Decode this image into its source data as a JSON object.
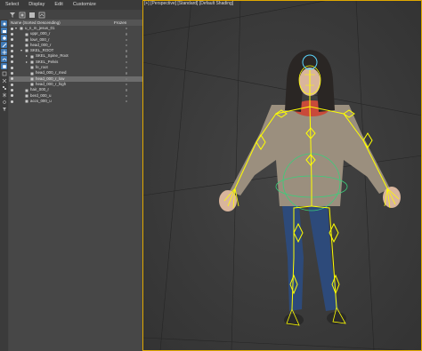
{
  "menu": {
    "items": [
      {
        "label": "Select"
      },
      {
        "label": "Display"
      },
      {
        "label": "Edit"
      },
      {
        "label": "Customize"
      }
    ]
  },
  "explorer": {
    "columns": {
      "name": "Name (Sorted Descending)",
      "frozen": "Frozen"
    },
    "rows": [
      {
        "label": "u_n_m_jesus_01",
        "level": 0,
        "expander": "▾",
        "selected": false
      },
      {
        "label": "uppr_000_r",
        "level": 1,
        "expander": "",
        "selected": false
      },
      {
        "label": "lowr_000_r",
        "level": 1,
        "expander": "",
        "selected": false
      },
      {
        "label": "head_000_r",
        "level": 1,
        "expander": "",
        "selected": false
      },
      {
        "label": "SKEL_ROOT",
        "level": 1,
        "expander": "▾",
        "selected": false
      },
      {
        "label": "SKEL_Spine_Root",
        "level": 2,
        "expander": "▸",
        "selected": false
      },
      {
        "label": "SKEL_Pelvis",
        "level": 2,
        "expander": "▸",
        "selected": false
      },
      {
        "label": "fe_root",
        "level": 2,
        "expander": "",
        "selected": false
      },
      {
        "label": "head_000_r_med",
        "level": 2,
        "expander": "",
        "selected": false
      },
      {
        "label": "head_000_r_low",
        "level": 2,
        "expander": "",
        "selected": true
      },
      {
        "label": "head_000_r_high",
        "level": 2,
        "expander": "",
        "selected": false
      },
      {
        "label": "hair_000_r",
        "level": 1,
        "expander": "",
        "selected": false
      },
      {
        "label": "berd_000_u",
        "level": 1,
        "expander": "",
        "selected": false
      },
      {
        "label": "accs_000_u",
        "level": 1,
        "expander": "",
        "selected": false
      }
    ]
  },
  "viewport": {
    "label": "[+] [Perspective] [Standard] [Default Shading]"
  },
  "colors": {
    "rig": "#ffff00",
    "accent": "#3f79b6",
    "viewport_border": "#e0a800",
    "coat": "#9b8f7e",
    "jeans": "#2d4a7a",
    "hair": "#2a2624",
    "skin": "#d9b59c",
    "collar": "#c94a3a",
    "helper_ring": "#38d07a"
  },
  "icons": {
    "toolbar": [
      "filter-icon",
      "layers-icon",
      "hierarchy-icon",
      "display-icon"
    ],
    "side": [
      "eye-icon",
      "camera-icon",
      "light-icon",
      "bone-icon",
      "helper-icon",
      "shape-icon",
      "geometry-icon",
      "container-icon",
      "xref-icon",
      "group-icon",
      "frozen-icon",
      "hidden-icon",
      "filter-icon"
    ]
  }
}
